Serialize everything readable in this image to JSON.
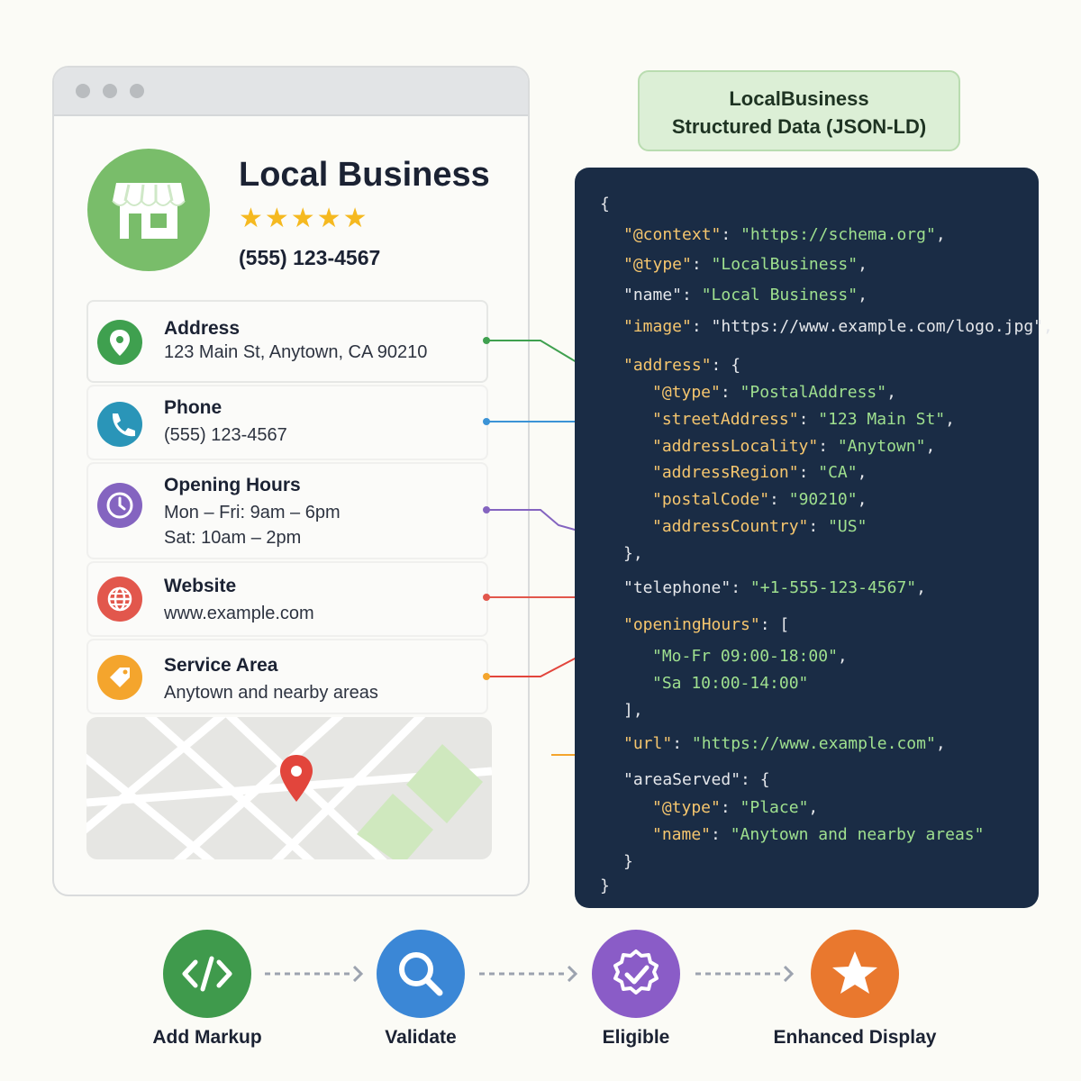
{
  "business": {
    "name": "Local Business",
    "stars": "★★★★★",
    "phone": "(555) 123-4567"
  },
  "info": {
    "address": {
      "title": "Address",
      "line1": "123 Main St, Anytown, CA 90210",
      "icon": "location-pin-icon",
      "color": "#3fa04f"
    },
    "phone": {
      "title": "Phone",
      "line1": "(555) 123-4567",
      "icon": "phone-icon",
      "color": "#2a95b8"
    },
    "hours": {
      "title": "Opening Hours",
      "line1": "Mon – Fri: 9am – 6pm",
      "line2": "Sat: 10am – 2pm",
      "icon": "clock-icon",
      "color": "#8464c0"
    },
    "website": {
      "title": "Website",
      "line1": "www.example.com",
      "icon": "globe-icon",
      "color": "#e2574c"
    },
    "service_area": {
      "title": "Service Area",
      "line1": "Anytown and nearby areas",
      "icon": "tag-icon",
      "color": "#f4a52d"
    }
  },
  "jsonld": {
    "title_line1": "LocalBusiness",
    "title_line2": "Structured Data (JSON-LD)",
    "lines": {
      "l1": "{",
      "context_k": "\"@context\"",
      "context_v": "\"https://schema.org\"",
      "type_k": "\"@type\"",
      "type_v": "\"LocalBusiness\"",
      "name_k": "\"name\"",
      "name_v": "\"Local Business\"",
      "image_k": "\"image\"",
      "image_v": "\"https://www.example.com/logo.jpg\"",
      "address_k": "\"address\"",
      "addr_type_k": "\"@type\"",
      "addr_type_v": "\"PostalAddress\"",
      "street_k": "\"streetAddress\"",
      "street_v": "\"123 Main St\"",
      "locality_k": "\"addressLocality\"",
      "locality_v": "\"Anytown\"",
      "region_k": "\"addressRegion\"",
      "region_v": "\"CA\"",
      "postal_k": "\"postalCode\"",
      "postal_v": "\"90210\"",
      "country_k": "\"addressCountry\"",
      "country_v": "\"US\"",
      "telephone_k": "\"telephone\"",
      "telephone_v": "\"+1-555-123-4567\"",
      "hours_k": "\"openingHours\"",
      "hours_v1": "\"Mo-Fr 09:00-18:00\"",
      "hours_v2": "\"Sa 10:00-14:00\"",
      "url_k": "\"url\"",
      "url_v": "\"https://www.example.com\"",
      "area_k": "\"areaServed\"",
      "area_type_k": "\"@type\"",
      "area_type_v": "\"Place\"",
      "area_name_k": "\"name\"",
      "area_name_v": "\"Anytown and nearby areas\""
    }
  },
  "flow": [
    {
      "label": "Add Markup",
      "icon": "code-icon",
      "color": "#3f9a4c"
    },
    {
      "label": "Validate",
      "icon": "search-icon",
      "color": "#3b87d6"
    },
    {
      "label": "Eligible",
      "icon": "check-badge-icon",
      "color": "#8a5cc7"
    },
    {
      "label": "Enhanced Display",
      "icon": "star-icon",
      "color": "#e9782e"
    }
  ]
}
